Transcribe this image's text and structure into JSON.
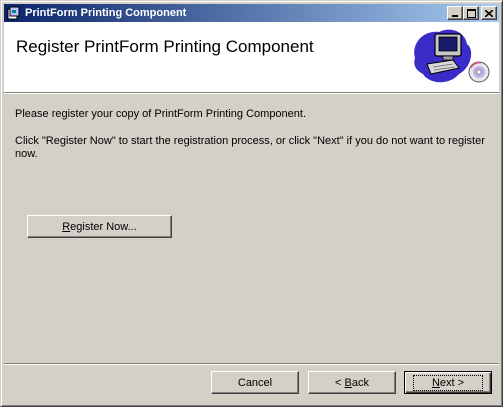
{
  "window": {
    "title": "PrintForm Printing Component"
  },
  "header": {
    "title": "Register PrintForm Printing Component",
    "graphic_icon": "computer-with-cd-icon"
  },
  "body": {
    "line1": "Please register your copy of PrintForm Printing Component.",
    "line2": "Click \"Register Now\" to start the registration process, or click \"Next\" if you do not want to register now."
  },
  "register_button": {
    "accel": "R",
    "rest": "egister Now..."
  },
  "footer": {
    "cancel_label": "Cancel",
    "back_prefix": "< ",
    "back_accel": "B",
    "back_rest": "ack",
    "next_accel": "N",
    "next_rest": "ext >"
  },
  "colors": {
    "titlebar_start": "#0a246a",
    "titlebar_end": "#a6caf0",
    "face": "#d4d0c8"
  }
}
